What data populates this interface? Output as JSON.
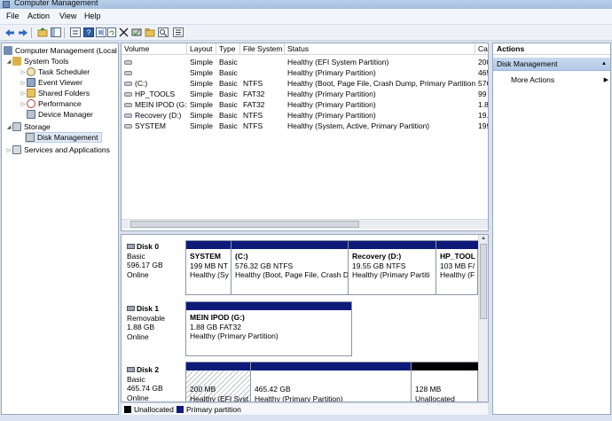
{
  "window": {
    "title": "Computer Management"
  },
  "menu": [
    "File",
    "Action",
    "View",
    "Help"
  ],
  "toolbar": {
    "icons": [
      "back-arrow-icon",
      "forward-arrow-icon",
      "up-folder-icon",
      "show-hide-tree-icon",
      "help-icon",
      "properties-icon",
      "refresh-icon",
      "delete-icon",
      "check-disk-icon",
      "open-folder-icon",
      "search-icon",
      "export-icon"
    ]
  },
  "tree": {
    "root": "Computer Management (Local",
    "system_tools": "System Tools",
    "task_scheduler": "Task Scheduler",
    "event_viewer": "Event Viewer",
    "shared_folders": "Shared Folders",
    "performance": "Performance",
    "device_manager": "Device Manager",
    "storage": "Storage",
    "disk_management": "Disk Management",
    "services": "Services and Applications"
  },
  "volumes": {
    "headers": [
      "Volume",
      "Layout",
      "Type",
      "File System",
      "Status",
      "Ca"
    ],
    "rows": [
      {
        "volume": "",
        "layout": "Simple",
        "type": "Basic",
        "fs": "",
        "status": "Healthy (EFI System Partition)",
        "cap": "200"
      },
      {
        "volume": "",
        "layout": "Simple",
        "type": "Basic",
        "fs": "",
        "status": "Healthy (Primary Partition)",
        "cap": "465"
      },
      {
        "volume": "(C:)",
        "layout": "Simple",
        "type": "Basic",
        "fs": "NTFS",
        "status": "Healthy (Boot, Page File, Crash Dump, Primary Partition)",
        "cap": "576"
      },
      {
        "volume": "HP_TOOLS",
        "layout": "Simple",
        "type": "Basic",
        "fs": "FAT32",
        "status": "Healthy (Primary Partition)",
        "cap": "99"
      },
      {
        "volume": "MEIN IPOD (G:)",
        "layout": "Simple",
        "type": "Basic",
        "fs": "FAT32",
        "status": "Healthy (Primary Partition)",
        "cap": "1.8"
      },
      {
        "volume": "Recovery (D:)",
        "layout": "Simple",
        "type": "Basic",
        "fs": "NTFS",
        "status": "Healthy (Primary Partition)",
        "cap": "19."
      },
      {
        "volume": "SYSTEM",
        "layout": "Simple",
        "type": "Basic",
        "fs": "NTFS",
        "status": "Healthy (System, Active, Primary Partition)",
        "cap": "199"
      }
    ]
  },
  "disks": [
    {
      "name": "Disk 0",
      "type": "Basic",
      "size": "596.17 GB",
      "state": "Online",
      "partitions": [
        {
          "name": "SYSTEM",
          "detail": "199 MB NT",
          "status": "Healthy (Sy"
        },
        {
          "name": "(C:)",
          "detail": "576.32 GB NTFS",
          "status": "Healthy (Boot, Page File, Crash D"
        },
        {
          "name": "Recovery  (D:)",
          "detail": "19.55 GB NTFS",
          "status": "Healthy (Primary Partiti"
        },
        {
          "name": "HP_TOOL",
          "detail": "103 MB F/",
          "status": "Healthy (F"
        }
      ]
    },
    {
      "name": "Disk 1",
      "type": "Removable",
      "size": "1.88 GB",
      "state": "Online",
      "partitions": [
        {
          "name": "MEIN IPOD  (G:)",
          "detail": "1.88 GB FAT32",
          "status": "Healthy (Primary Partition)"
        }
      ]
    },
    {
      "name": "Disk 2",
      "type": "Basic",
      "size": "465.74 GB",
      "state": "Online",
      "partitions": [
        {
          "name": "",
          "detail": "200 MB",
          "status": "Healthy (EFI Syst"
        },
        {
          "name": "",
          "detail": "465.42 GB",
          "status": "Healthy (Primary Partition)"
        },
        {
          "name": "",
          "detail": "128 MB",
          "status": "Unallocated"
        }
      ]
    }
  ],
  "legend": {
    "unallocated": "Unallocated",
    "primary": "Primary partition"
  },
  "actions": {
    "header": "Actions",
    "section": "Disk Management",
    "more": "More Actions"
  },
  "colors": {
    "primary_partition": "#0e1a7a",
    "unallocated": "#000000",
    "selection": "#dfe9f7"
  }
}
